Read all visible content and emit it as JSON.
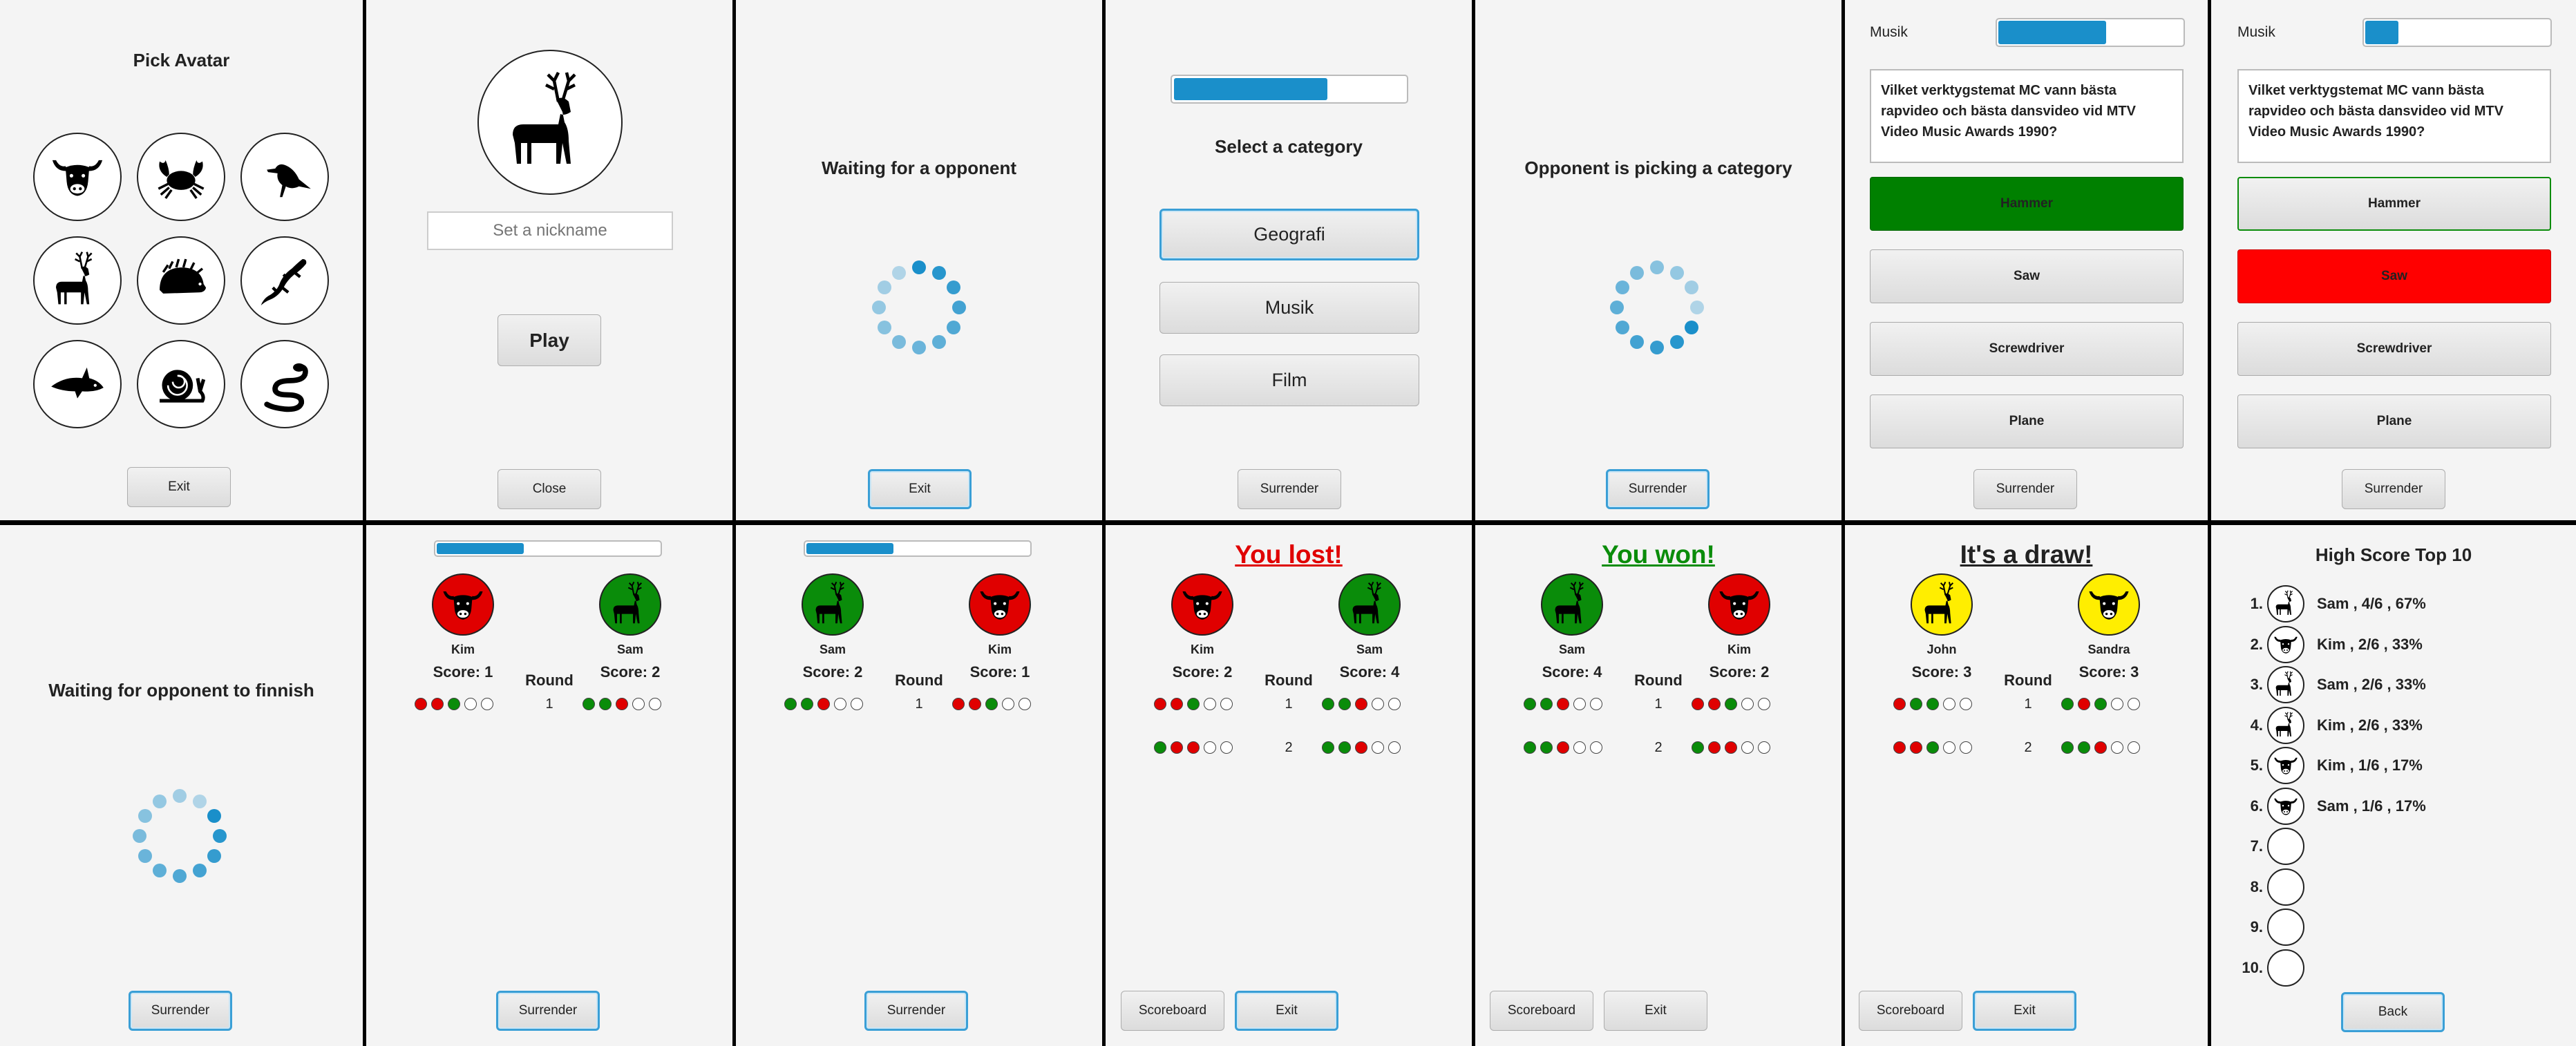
{
  "colors": {
    "accent": "#1a8fca",
    "win": "#0a8c0a",
    "lose": "#e00000",
    "draw": "#ffee00",
    "text": "#222222"
  },
  "pick_avatar": {
    "title": "Pick Avatar",
    "exit": "Exit",
    "avatars": [
      "bull-icon",
      "crab-icon",
      "raven-icon",
      "deer-icon",
      "hedgehog-icon",
      "lizard-icon",
      "shark-icon",
      "snail-icon",
      "snake-icon"
    ]
  },
  "nickname": {
    "placeholder": "Set a nickname",
    "play": "Play",
    "close": "Close",
    "avatar": "deer-icon"
  },
  "waiting": {
    "title": "Waiting for a opponent",
    "exit": "Exit"
  },
  "category": {
    "title": "Select a category",
    "progress": 0.67,
    "options": [
      "Geografi",
      "Musik",
      "Film"
    ],
    "surrender": "Surrender"
  },
  "opponent_picking": {
    "title": "Opponent is picking a category",
    "surrender": "Surrender"
  },
  "question1": {
    "category": "Musik",
    "progress": 0.6,
    "question": "Vilket verktygstemat MC vann bästa rapvideo och bästa dansvideo vid MTV Video Music Awards 1990?",
    "answers": [
      "Hammer",
      "Saw",
      "Screwdriver",
      "Plane"
    ],
    "surrender": "Surrender"
  },
  "question2": {
    "category": "Musik",
    "progress": 0.2,
    "question": "Vilket verktygstemat MC vann bästa rapvideo och bästa dansvideo vid MTV Video Music Awards 1990?",
    "answers": [
      "Hammer",
      "Saw",
      "Screwdriver",
      "Plane"
    ],
    "surrender": "Surrender"
  },
  "waiting_finish": {
    "title": "Waiting for opponent to finnish",
    "surrender": "Surrender"
  },
  "round1": {
    "progress": 0.4,
    "p1": {
      "name": "Kim",
      "score": "Score: 1",
      "color": "#e00000",
      "avatar": "bull-icon"
    },
    "p2": {
      "name": "Sam",
      "score": "Score: 2",
      "color": "#0a8c0a",
      "avatar": "deer-icon"
    },
    "round_label": "Round",
    "rows": [
      {
        "n": "1",
        "a": [
          "r",
          "r",
          "g",
          "e",
          "e"
        ],
        "b": [
          "g",
          "g",
          "r",
          "e",
          "e"
        ]
      }
    ],
    "surrender": "Surrender"
  },
  "round2": {
    "progress": 0.4,
    "p1": {
      "name": "Sam",
      "score": "Score: 2",
      "color": "#0a8c0a",
      "avatar": "deer-icon"
    },
    "p2": {
      "name": "Kim",
      "score": "Score: 1",
      "color": "#e00000",
      "avatar": "bull-icon"
    },
    "round_label": "Round",
    "rows": [
      {
        "n": "1",
        "a": [
          "g",
          "g",
          "r",
          "e",
          "e"
        ],
        "b": [
          "r",
          "r",
          "g",
          "e",
          "e"
        ]
      }
    ],
    "surrender": "Surrender"
  },
  "lost": {
    "title": "You lost!",
    "p1": {
      "name": "Kim",
      "score": "Score: 2",
      "color": "#e00000",
      "avatar": "bull-icon"
    },
    "p2": {
      "name": "Sam",
      "score": "Score: 4",
      "color": "#0a8c0a",
      "avatar": "deer-icon"
    },
    "round_label": "Round",
    "rows": [
      {
        "n": "1",
        "a": [
          "r",
          "r",
          "g",
          "e",
          "e"
        ],
        "b": [
          "g",
          "g",
          "r",
          "e",
          "e"
        ]
      },
      {
        "n": "2",
        "a": [
          "g",
          "r",
          "r",
          "e",
          "e"
        ],
        "b": [
          "g",
          "g",
          "r",
          "e",
          "e"
        ]
      }
    ],
    "scoreboard": "Scoreboard",
    "exit": "Exit"
  },
  "won": {
    "title": "You won!",
    "p1": {
      "name": "Sam",
      "score": "Score: 4",
      "color": "#0a8c0a",
      "avatar": "deer-icon"
    },
    "p2": {
      "name": "Kim",
      "score": "Score: 2",
      "color": "#e00000",
      "avatar": "bull-icon"
    },
    "round_label": "Round",
    "rows": [
      {
        "n": "1",
        "a": [
          "g",
          "g",
          "r",
          "e",
          "e"
        ],
        "b": [
          "r",
          "r",
          "g",
          "e",
          "e"
        ]
      },
      {
        "n": "2",
        "a": [
          "g",
          "g",
          "r",
          "e",
          "e"
        ],
        "b": [
          "g",
          "r",
          "r",
          "e",
          "e"
        ]
      }
    ],
    "scoreboard": "Scoreboard",
    "exit": "Exit"
  },
  "draw": {
    "title": "It's a draw!",
    "p1": {
      "name": "John",
      "score": "Score: 3",
      "color": "#ffee00",
      "avatar": "deer-icon"
    },
    "p2": {
      "name": "Sandra",
      "score": "Score: 3",
      "color": "#ffee00",
      "avatar": "bull-icon"
    },
    "round_label": "Round",
    "rows": [
      {
        "n": "1",
        "a": [
          "r",
          "g",
          "g",
          "e",
          "e"
        ],
        "b": [
          "g",
          "r",
          "g",
          "e",
          "e"
        ]
      },
      {
        "n": "2",
        "a": [
          "r",
          "r",
          "g",
          "e",
          "e"
        ],
        "b": [
          "g",
          "g",
          "r",
          "e",
          "e"
        ]
      }
    ],
    "scoreboard": "Scoreboard",
    "exit": "Exit"
  },
  "highscore": {
    "title": "High Score Top 10",
    "back": "Back",
    "rows": [
      {
        "n": "1.",
        "text": "Sam  ,  4/6  ,  67%",
        "avatar": "deer-icon"
      },
      {
        "n": "2.",
        "text": "Kim  ,  2/6  ,  33%",
        "avatar": "bull-icon"
      },
      {
        "n": "3.",
        "text": "Sam  ,  2/6  ,  33%",
        "avatar": "deer-icon"
      },
      {
        "n": "4.",
        "text": "Kim  ,  2/6  ,  33%",
        "avatar": "deer-icon"
      },
      {
        "n": "5.",
        "text": "Kim  ,  1/6  ,  17%",
        "avatar": "bull-icon"
      },
      {
        "n": "6.",
        "text": "Sam  ,  1/6  ,  17%",
        "avatar": "bull-icon"
      },
      {
        "n": "7.",
        "text": "",
        "avatar": ""
      },
      {
        "n": "8.",
        "text": "",
        "avatar": ""
      },
      {
        "n": "9.",
        "text": "",
        "avatar": ""
      },
      {
        "n": "10.",
        "text": "",
        "avatar": ""
      }
    ]
  }
}
